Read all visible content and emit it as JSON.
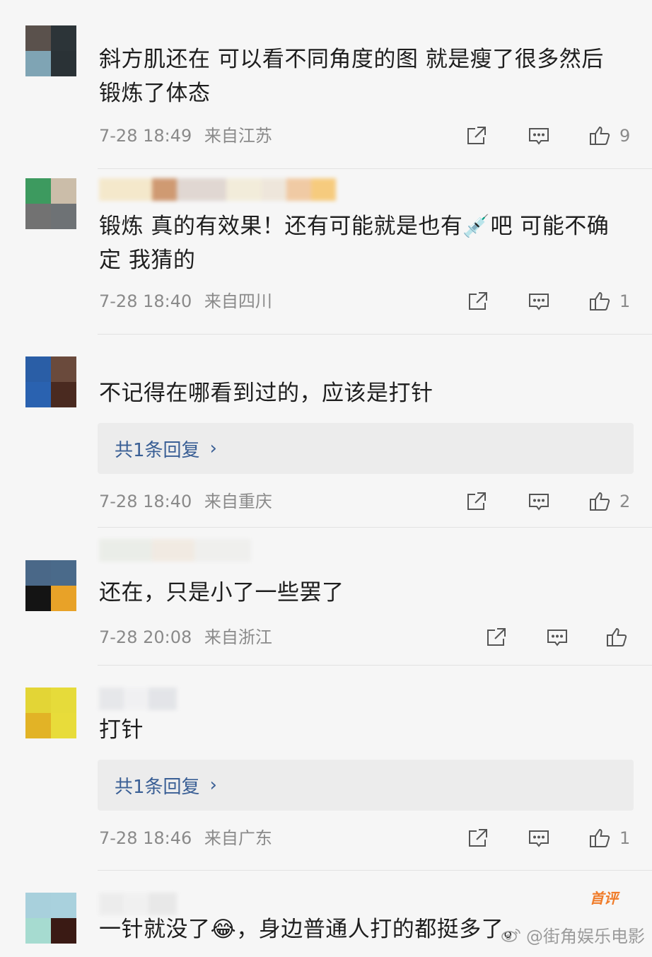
{
  "comments": [
    {
      "text": "斜方肌还在 可以看不同角度的图 就是瘦了很多然后锻炼了体态",
      "date": "7-28 18:49",
      "location": "来自江苏",
      "likes": "9",
      "reply_label": ""
    },
    {
      "text": "锻炼 真的有效果！还有可能就是也有💉吧 可能不确定 我猜的",
      "date": "7-28 18:40",
      "location": "来自四川",
      "likes": "1",
      "reply_label": ""
    },
    {
      "text": "不记得在哪看到过的，应该是打针",
      "date": "7-28 18:40",
      "location": "来自重庆",
      "likes": "2",
      "reply_label": "共1条回复"
    },
    {
      "text": "还在，只是小了一些罢了",
      "date": "7-28 20:08",
      "location": "来自浙江",
      "likes": "",
      "reply_label": ""
    },
    {
      "text": "打针",
      "date": "7-28 18:46",
      "location": "来自广东",
      "likes": "1",
      "reply_label": "共1条回复"
    },
    {
      "text": "一针就没了😂，身边普通人打的都挺多了。",
      "badge": "首评"
    }
  ],
  "reply_chevron": "›",
  "watermark": "@街角娱乐电影",
  "colors": {
    "reply_link": "#3a5f95",
    "badge": "#f07c2a",
    "meta": "#8a8a8a"
  },
  "icons": [
    "share-icon",
    "comment-icon",
    "like-icon"
  ]
}
